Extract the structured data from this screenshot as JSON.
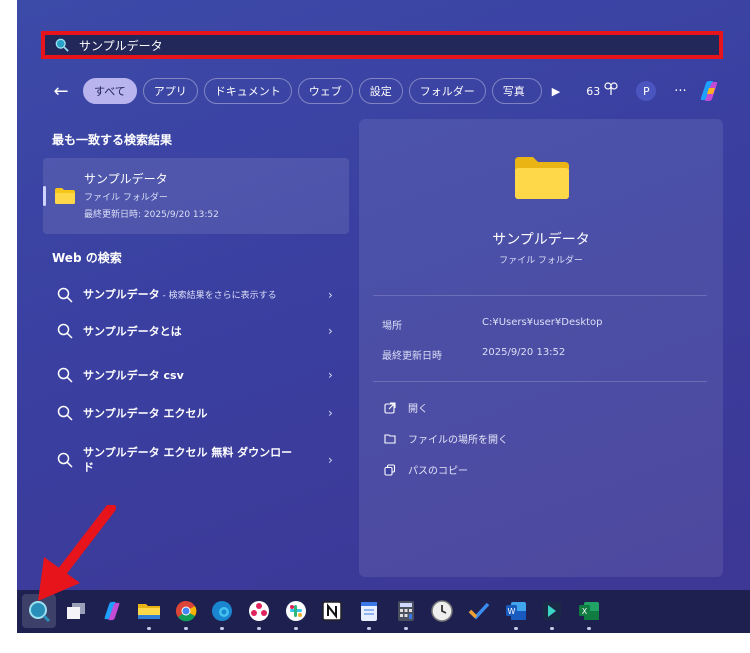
{
  "search": {
    "query": "サンプルデータ"
  },
  "filters": {
    "back": "←",
    "chips": [
      "すべて",
      "アプリ",
      "ドキュメント",
      "ウェブ",
      "設定",
      "フォルダー",
      "写真"
    ],
    "play": "▶",
    "count": "63",
    "profile": "P",
    "more": "···"
  },
  "best_match": {
    "heading": "最も一致する検索結果",
    "title": "サンプルデータ",
    "type": "ファイル フォルダー",
    "modified": "最終更新日時: 2025/9/20 13:52"
  },
  "web": {
    "heading": "Web の検索",
    "items": [
      {
        "text": "サンプルデータ",
        "sub": " - 検索結果をさらに表示する"
      },
      {
        "text": "サンプルデータとは",
        "sub": ""
      },
      {
        "text": "サンプルデータ csv",
        "sub": ""
      },
      {
        "text": "サンプルデータ エクセル",
        "sub": ""
      },
      {
        "text": "サンプルデータ エクセル 無料 ダウンロード",
        "sub": ""
      }
    ],
    "chevron": "›"
  },
  "detail": {
    "name": "サンプルデータ",
    "type": "ファイル フォルダー",
    "location_label": "場所",
    "location_value": "C:¥Users¥user¥Desktop",
    "modified_label": "最終更新日時",
    "modified_value": "2025/9/20 13:52",
    "actions": [
      "開く",
      "ファイルの場所を開く",
      "パスのコピー"
    ]
  },
  "taskbar": {
    "icons": [
      "search-icon",
      "task-view-icon",
      "copilot-icon",
      "file-explorer-icon",
      "chrome-icon",
      "edge-icon",
      "app-icon",
      "slack-icon",
      "notion-icon",
      "notepad-icon",
      "calculator-icon",
      "clock-icon",
      "todo-icon",
      "word-icon",
      "app-arrow-icon",
      "excel-icon"
    ]
  },
  "colors": {
    "highlight": "#e8141b",
    "folder": "#f5c518",
    "accent": "#b9b4ee"
  }
}
